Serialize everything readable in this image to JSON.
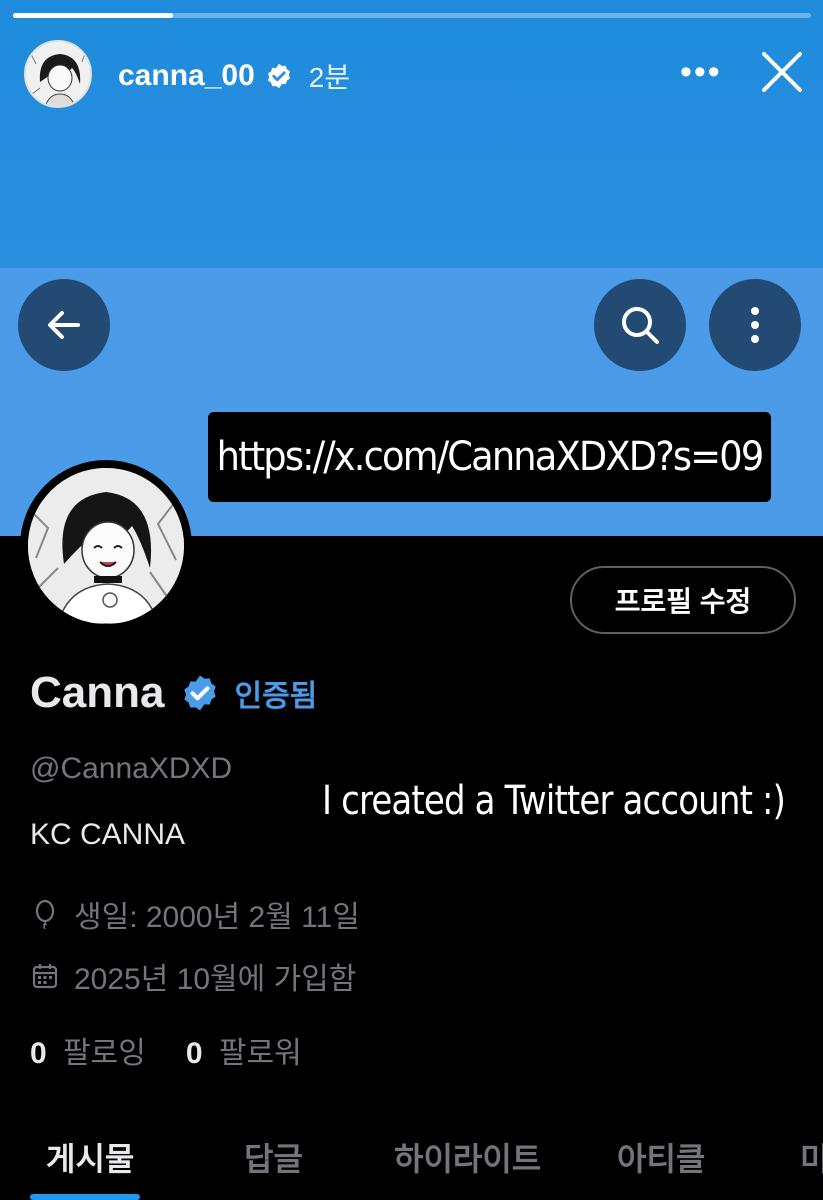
{
  "story": {
    "progress_fraction": 0.2,
    "username": "canna_00",
    "time": "2분",
    "more_icon": "more-dots-icon",
    "close_icon": "close-icon"
  },
  "profile": {
    "url_sticker": "https://x.com/CannaXDXD?s=09",
    "edit_button": "프로필 수정",
    "display_name": "Canna",
    "verified_label": "인증됨",
    "handle": "@CannaXDXD",
    "caption_sticker": "I created a Twitter account :)",
    "bio": "KC CANNA",
    "birthday": "생일: 2000년 2월 11일",
    "joined": "2025년 10월에 가입함",
    "following_count": "0",
    "following_label": "팔로잉",
    "followers_count": "0",
    "followers_label": "팔로워"
  },
  "tabs": [
    {
      "label": "게시물"
    },
    {
      "label": "답글"
    },
    {
      "label": "하이라이트"
    },
    {
      "label": "아티클"
    },
    {
      "label": "미"
    }
  ],
  "colors": {
    "story_bg": "#1f8bdc",
    "banner": "#4c9be8",
    "accent": "#1d9bf0",
    "verified": "#4c9be8"
  }
}
